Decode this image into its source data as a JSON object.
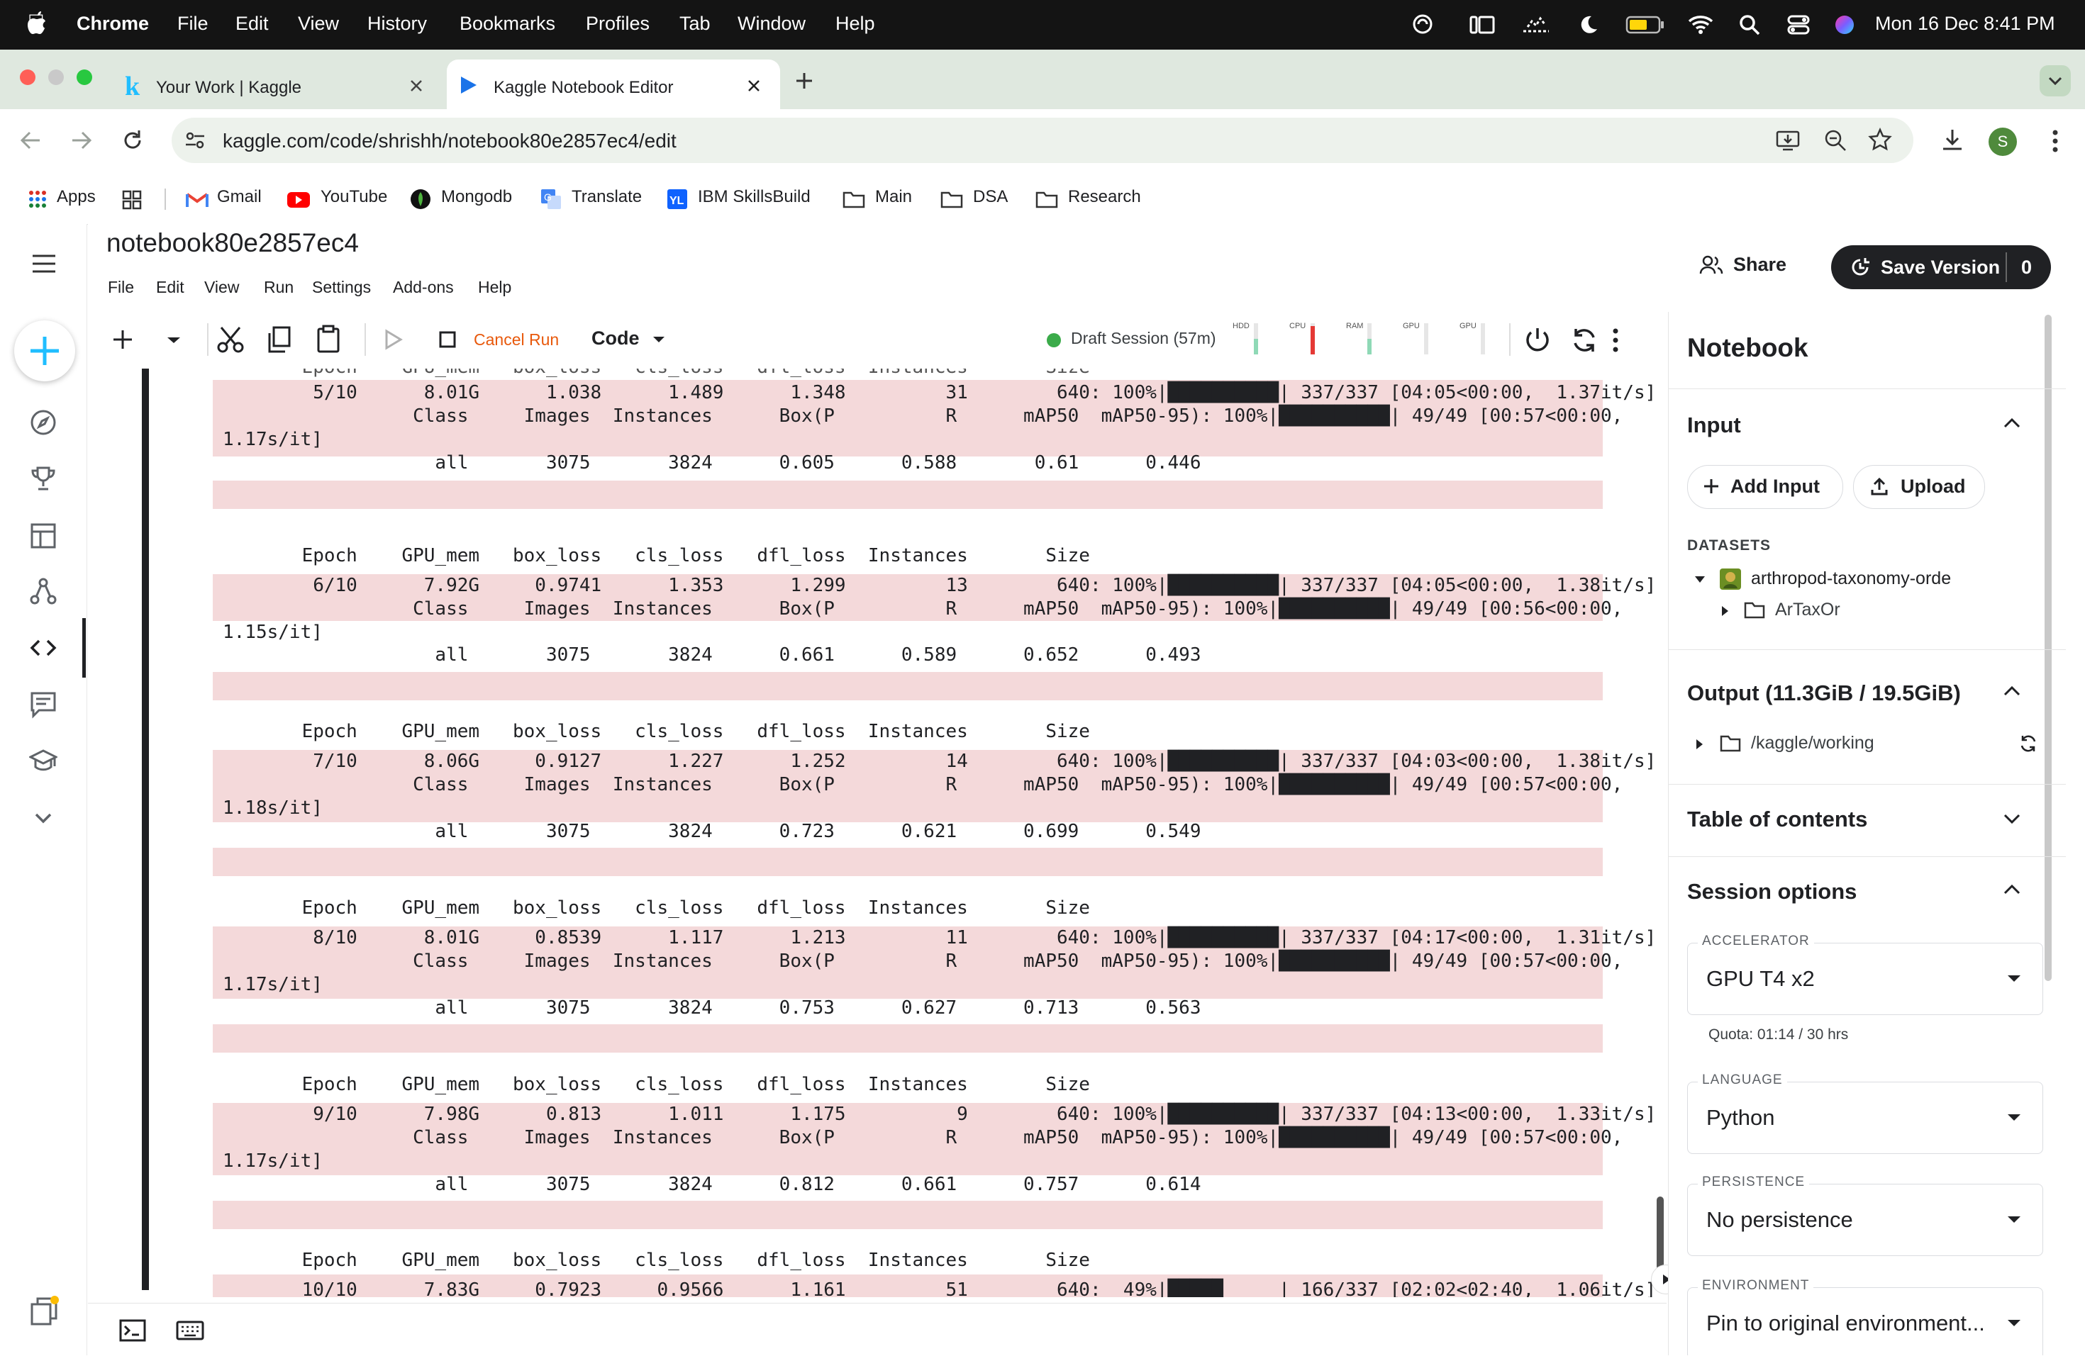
{
  "menubar": {
    "app": "Chrome",
    "items": [
      "File",
      "Edit",
      "View",
      "History",
      "Bookmarks",
      "Profiles",
      "Tab",
      "Window",
      "Help"
    ],
    "clock": "Mon 16 Dec  8:41 PM"
  },
  "tabs": [
    {
      "title": "Your Work | Kaggle"
    },
    {
      "title": "Kaggle Notebook Editor"
    }
  ],
  "address": {
    "url": "kaggle.com/code/shrishh/notebook80e2857ec4/edit"
  },
  "profile_initial": "S",
  "bookmarks": [
    "Apps",
    "Gmail",
    "YouTube",
    "Mongodb",
    "Translate",
    "IBM SkillsBuild",
    "Main",
    "DSA",
    "Research"
  ],
  "notebook": {
    "title": "notebook80e2857ec4",
    "menu": [
      "File",
      "Edit",
      "View",
      "Run",
      "Settings",
      "Add-ons",
      "Help"
    ],
    "share_label": "Share",
    "save_label": "Save Version",
    "save_count": "0",
    "cancel_run_label": "Cancel Run",
    "cell_type": "Code",
    "session_status": "Draft Session (57m)",
    "meters": [
      "HDD",
      "CPU",
      "RAM",
      "GPU",
      "GPU"
    ]
  },
  "output": {
    "partial_top": "       Epoch    GPU_mem   box_loss   cls_loss   dfl_loss  Instances       Size",
    "epochs": [
      {
        "row": "        5/10      8.01G      1.038      1.489      1.348         31        640: 100%|██████████| 337/337 [04:05<00:00,  1.37it/s]",
        "cls": "                 Class     Images  Instances      Box(P          R      mAP50  mAP50-95): 100%|██████████| 49/49 [00:57<00:00,",
        "wrap": "1.17s/it]",
        "all": "                   all       3075       3824      0.605      0.588       0.61      0.446"
      },
      {
        "row": "        6/10      7.92G     0.9741      1.353      1.299         13        640: 100%|██████████| 337/337 [04:05<00:00,  1.38it/s]",
        "cls": "                 Class     Images  Instances      Box(P          R      mAP50  mAP50-95): 100%|██████████| 49/49 [00:56<00:00,",
        "wrap": "1.15s/it]",
        "all": "                   all       3075       3824      0.661      0.589      0.652      0.493"
      },
      {
        "row": "        7/10      8.06G     0.9127      1.227      1.252         14        640: 100%|██████████| 337/337 [04:03<00:00,  1.38it/s]",
        "cls": "                 Class     Images  Instances      Box(P          R      mAP50  mAP50-95): 100%|██████████| 49/49 [00:57<00:00,",
        "wrap": "1.18s/it]",
        "all": "                   all       3075       3824      0.723      0.621      0.699      0.549"
      },
      {
        "row": "        8/10      8.01G     0.8539      1.117      1.213         11        640: 100%|██████████| 337/337 [04:17<00:00,  1.31it/s]",
        "cls": "                 Class     Images  Instances      Box(P          R      mAP50  mAP50-95): 100%|██████████| 49/49 [00:57<00:00,",
        "wrap": "1.17s/it]",
        "all": "                   all       3075       3824      0.753      0.627      0.713      0.563"
      },
      {
        "row": "        9/10      7.98G      0.813      1.011      1.175          9        640: 100%|██████████| 337/337 [04:13<00:00,  1.33it/s]",
        "cls": "                 Class     Images  Instances      Box(P          R      mAP50  mAP50-95): 100%|██████████| 49/49 [00:57<00:00,",
        "wrap": "1.17s/it]",
        "all": "                   all       3075       3824      0.812      0.661      0.757      0.614"
      }
    ],
    "header": "       Epoch    GPU_mem   box_loss   cls_loss   dfl_loss  Instances       Size",
    "last_row": "       10/10      7.83G     0.7923     0.9566      1.161         51        640:  49%|█████     | 166/337 [02:02<02:40,  1.06it/s]"
  },
  "right_panel": {
    "title": "Notebook",
    "input_heading": "Input",
    "add_input_label": "Add Input",
    "upload_label": "Upload",
    "datasets_label": "DATASETS",
    "dataset_name": "arthropod-taxonomy-orde",
    "dataset_folder": "ArTaxOr",
    "output_heading": "Output (11.3GiB / 19.5GiB)",
    "output_folder": "/kaggle/working",
    "toc_heading": "Table of contents",
    "session_heading": "Session options",
    "accelerator_label": "ACCELERATOR",
    "accelerator_value": "GPU T4 x2",
    "quota": "Quota: 01:14 / 30 hrs",
    "language_label": "LANGUAGE",
    "language_value": "Python",
    "persistence_label": "PERSISTENCE",
    "persistence_value": "No persistence",
    "environment_label": "ENVIRONMENT",
    "environment_value": "Pin to original environment..."
  },
  "colors": {
    "output_band": "#f4d9da",
    "accent_blue": "#20beff",
    "cancel_run": "#e8590c",
    "session_dot": "#3bab4a"
  }
}
